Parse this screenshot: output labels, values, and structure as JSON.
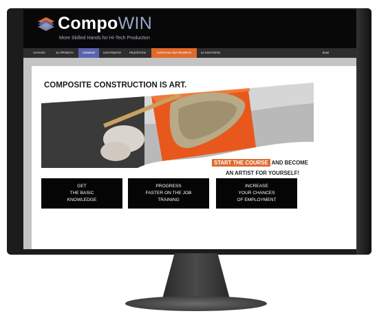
{
  "site": {
    "logo_main": "Compo",
    "logo_accent": "WIN",
    "tagline": "More Skilled Hands for Hi-Tech Production"
  },
  "nav": {
    "items": [
      {
        "label": "НАЧАЛО"
      },
      {
        "label": "ЗА ПРОЕКТА"
      },
      {
        "label": "НОВИНИ"
      },
      {
        "label": "КАК РАБОТИ"
      },
      {
        "label": "РЕЗУЛТАТИ"
      },
      {
        "label": "ЗАПОЧНИ ОБУЧЕНИЕТО"
      },
      {
        "label": "ЗА КОНТАКТИ"
      }
    ],
    "language": "Eesti",
    "colors": {
      "blue": "#5b63b0",
      "orange": "#e06a2d"
    }
  },
  "hero": {
    "title": "COMPOSITE CONSTRUCTION IS ART.",
    "cta_highlight": "START THE COURSE",
    "cta_rest": " AND BECOME",
    "cta_line2": "AN ARTIST FOR YOURSELF!"
  },
  "boxes": [
    {
      "text": "GET\nTHE BASIC\nKNOWLEDGE"
    },
    {
      "text": "PROGRESS\nFASTER ON THE JOB\nTRAINING"
    },
    {
      "text": "INCREASE\nYOUR CHANCES\nOF EMPLOYMENT"
    }
  ]
}
